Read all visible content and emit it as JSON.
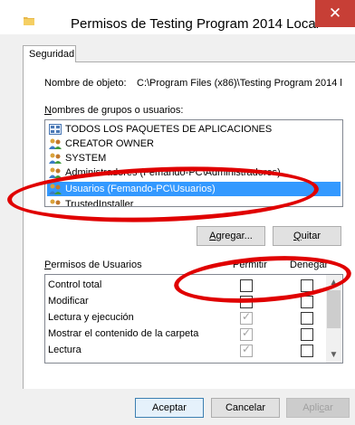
{
  "window": {
    "title": "Permisos de Testing Program 2014 Local",
    "close_glyph": "✕"
  },
  "tab": {
    "label": "Seguridad"
  },
  "object": {
    "label": "Nombre de objeto:",
    "value": "C:\\Program Files (x86)\\Testing Program 2014 l"
  },
  "groups": {
    "label_prefix": "N",
    "label_rest": "ombres de grupos o usuarios:",
    "items": [
      {
        "label": "TODOS LOS PAQUETES DE APLICACIONES",
        "icon": "packages-icon"
      },
      {
        "label": "CREATOR OWNER",
        "icon": "users-icon"
      },
      {
        "label": "SYSTEM",
        "icon": "users-icon"
      },
      {
        "label": "Administradores (Femando-PC\\Administradores)",
        "icon": "users-icon"
      },
      {
        "label": "Usuarios (Femando-PC\\Usuarios)",
        "icon": "users-icon",
        "selected": true
      },
      {
        "label": "TrustedInstaller",
        "icon": "users-icon"
      }
    ]
  },
  "buttons": {
    "add_prefix": "A",
    "add_rest": "gregar...",
    "remove_prefix": "Q",
    "remove_rest": "uitar",
    "ok": "Aceptar",
    "cancel": "Cancelar",
    "apply_prefix": "Apli",
    "apply_u": "c",
    "apply_rest": "ar"
  },
  "permissions": {
    "label_prefix": "P",
    "label_rest": "ermisos de Usuarios",
    "col_allow": "Permitir",
    "col_deny": "Denegar",
    "rows": [
      {
        "name": "Control total",
        "allow": false,
        "deny": false
      },
      {
        "name": "Modificar",
        "allow": false,
        "deny": false
      },
      {
        "name": "Lectura y ejecución",
        "allow": true,
        "deny": false
      },
      {
        "name": "Mostrar el contenido de la carpeta",
        "allow": true,
        "deny": false
      },
      {
        "name": "Lectura",
        "allow": true,
        "deny": false
      }
    ]
  },
  "colors": {
    "selection": "#3399ff",
    "annotation": "#e00000",
    "close": "#c73f36"
  }
}
